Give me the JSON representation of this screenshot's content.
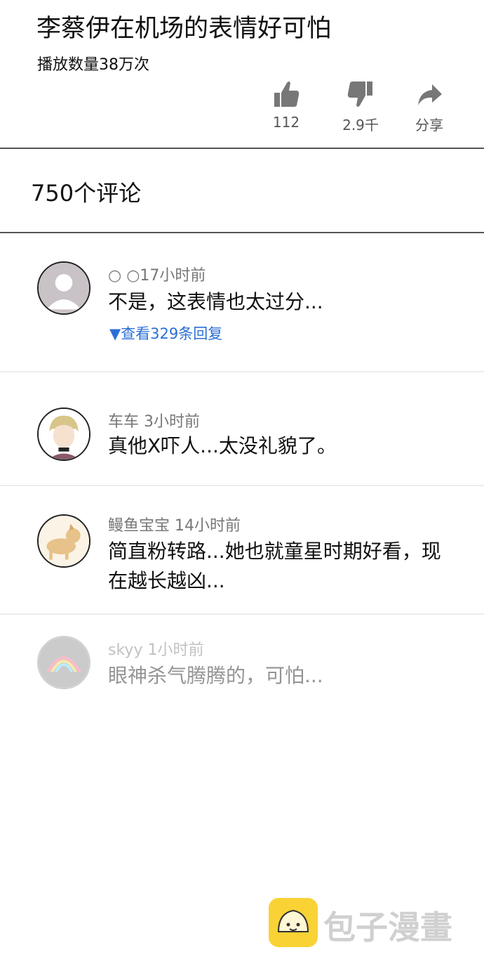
{
  "video": {
    "title": "李蔡伊在机场的表情好可怕",
    "views": "播放数量38万次",
    "actions": {
      "like_count": "112",
      "dislike_count": "2.9千",
      "share_label": "分享"
    }
  },
  "comments_header": {
    "count_label": "750个评论"
  },
  "comments": [
    {
      "author_time": "○ ○17小时前",
      "text": "不是，这表情也太过分...",
      "replies_label": "▼查看329条回复"
    },
    {
      "author_time": "车车 3小时前",
      "text": "真他X吓人...太没礼貌了。"
    },
    {
      "author_time": "鳗鱼宝宝 14小时前",
      "text": "简直粉转路...她也就童星时期好看，现在越长越凶..."
    },
    {
      "author_time": "skyy 1小时前",
      "text": "眼神杀气腾腾的，可怕..."
    }
  ],
  "watermark": {
    "text": "包子漫畫"
  },
  "colors": {
    "reply_link": "#2b6fd6",
    "watermark_badge": "#f9d235",
    "divider": "#555555"
  },
  "icons": [
    "thumbs-up-icon",
    "thumbs-down-icon",
    "share-icon"
  ]
}
